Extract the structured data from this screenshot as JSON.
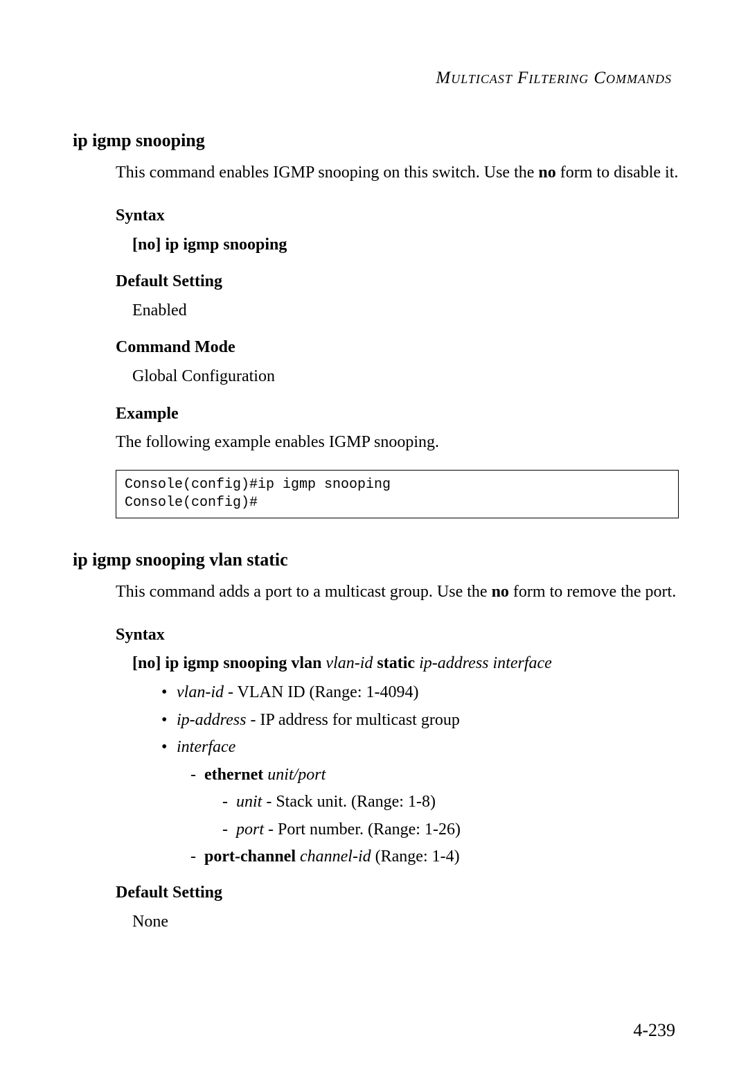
{
  "header": "Multicast Filtering Commands",
  "cmd1": {
    "title": "ip igmp snooping",
    "desc_pre": "This command enables IGMP snooping on this switch. Use the ",
    "desc_bold": "no",
    "desc_post": " form to disable it.",
    "syntax_label": "Syntax",
    "syntax_text": "[no] ip igmp snooping",
    "default_label": "Default Setting",
    "default_value": "Enabled",
    "mode_label": "Command Mode",
    "mode_value": "Global Configuration",
    "example_label": "Example",
    "example_desc": "The following example enables IGMP snooping.",
    "example_code": "Console(config)#ip igmp snooping\nConsole(config)#"
  },
  "cmd2": {
    "title": "ip igmp snooping vlan static",
    "desc_pre": "This command adds a port to a multicast group. Use the ",
    "desc_bold": "no",
    "desc_post": " form to remove the port.",
    "syntax_label": "Syntax",
    "syntax_p1": "[no] ip igmp snooping vlan",
    "syntax_p2": " vlan-id ",
    "syntax_p3": "static",
    "syntax_p4": " ip-address interface",
    "b1_i": "vlan-id",
    "b1_t": " - VLAN ID (Range: 1-4094)",
    "b2_i": "ip-address",
    "b2_t": " - IP address for multicast group",
    "b3_i": "interface",
    "s1_b": "ethernet",
    "s1_i": " unit/port",
    "s1a_i": "unit",
    "s1a_t": " - Stack unit. (Range: 1-8)",
    "s1b_i": "port",
    "s1b_t": " - Port number. (Range: 1-26)",
    "s2_b": "port-channel",
    "s2_i": " channel-id",
    "s2_t": " (Range: 1-4)",
    "default_label": "Default Setting",
    "default_value": "None"
  },
  "page_number": "4-239"
}
